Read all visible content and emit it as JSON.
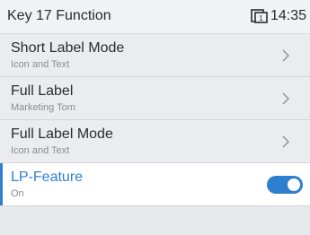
{
  "header": {
    "title": "Key 17 Function",
    "line_indicator": "1",
    "time": "14:35"
  },
  "items": [
    {
      "title": "Short Label Mode",
      "subtitle": "Icon and Text",
      "control": "chevron-right-icon"
    },
    {
      "title": "Full Label",
      "subtitle": "Marketing Tom",
      "control": "chevron-right-icon"
    },
    {
      "title": "Full Label Mode",
      "subtitle": "Icon and Text",
      "control": "chevron-right-icon"
    },
    {
      "title": "LP-Feature",
      "subtitle": "On",
      "control": "toggle-switch",
      "toggle_on": true,
      "selected": true
    }
  ],
  "colors": {
    "accent": "#2f7fd1",
    "background": "#e8e9ec",
    "selected_row": "#ffffff"
  }
}
